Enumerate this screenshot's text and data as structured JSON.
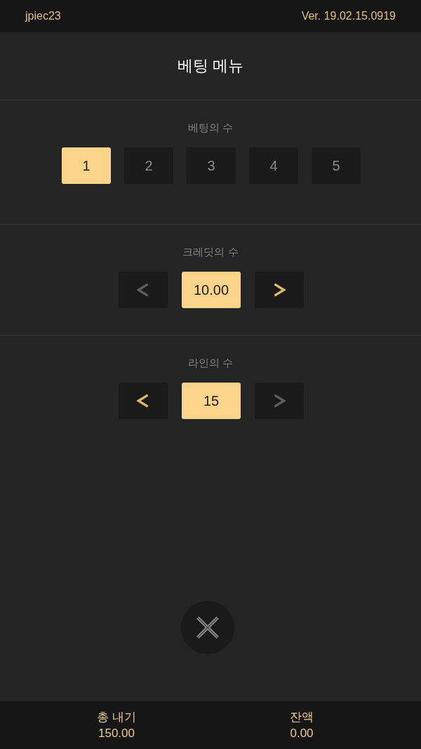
{
  "header": {
    "username": "jpiec23",
    "version": "Ver. 19.02.15.0919"
  },
  "title": "베팅 메뉴",
  "sections": [
    {
      "kind": "choices",
      "label": "베팅의 수",
      "options": [
        {
          "label": "1",
          "selected": true
        },
        {
          "label": "2",
          "selected": false
        },
        {
          "label": "3",
          "selected": false
        },
        {
          "label": "4",
          "selected": false
        },
        {
          "label": "5",
          "selected": false
        }
      ]
    },
    {
      "kind": "stepper",
      "label": "크레딧의 수",
      "value": "10.00",
      "decrease_disabled": true,
      "increase_disabled": false
    },
    {
      "kind": "stepper",
      "label": "라인의 수",
      "value": "15",
      "decrease_disabled": false,
      "increase_disabled": true
    }
  ],
  "footer": [
    {
      "label": "총 내기",
      "value": "150.00"
    },
    {
      "label": "잔액",
      "value": "0.00"
    }
  ]
}
